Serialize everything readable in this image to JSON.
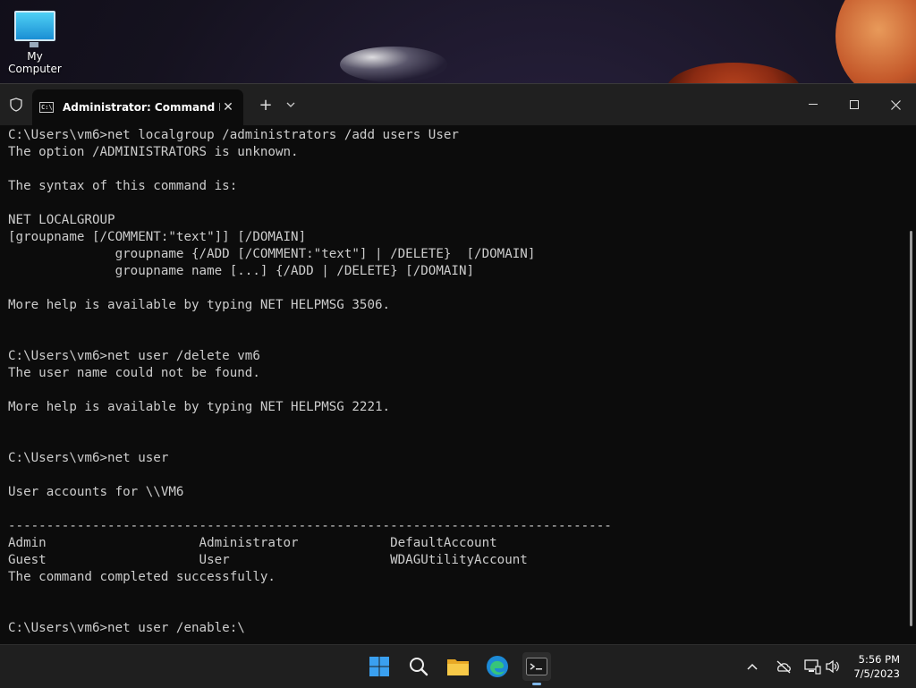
{
  "desktop": {
    "icon_label": "My Computer"
  },
  "window": {
    "tab_title": "Administrator: Command Prc",
    "cmd_icon_text": "C:\\",
    "new_tab": "+",
    "dropdown": "⌄",
    "close_tab": "✕",
    "minimize": "—",
    "maximize": "☐",
    "close": "✕"
  },
  "console": {
    "lines": [
      "C:\\Users\\vm6>net localgroup /administrators /add users User",
      "The option /ADMINISTRATORS is unknown.",
      "",
      "The syntax of this command is:",
      "",
      "NET LOCALGROUP",
      "[groupname [/COMMENT:\"text\"]] [/DOMAIN]",
      "              groupname {/ADD [/COMMENT:\"text\"] | /DELETE}  [/DOMAIN]",
      "              groupname name [...] {/ADD | /DELETE} [/DOMAIN]",
      "",
      "More help is available by typing NET HELPMSG 3506.",
      "",
      "",
      "C:\\Users\\vm6>net user /delete vm6",
      "The user name could not be found.",
      "",
      "More help is available by typing NET HELPMSG 2221.",
      "",
      "",
      "C:\\Users\\vm6>net user",
      "",
      "User accounts for \\\\VM6",
      "",
      "-------------------------------------------------------------------------------",
      "Admin                    Administrator            DefaultAccount",
      "Guest                    User                     WDAGUtilityAccount",
      "The command completed successfully.",
      "",
      "",
      "C:\\Users\\vm6>net user /enable:\\"
    ]
  },
  "taskbar": {
    "tray_chevron": "^",
    "time": "5:56 PM",
    "date": "7/5/2023"
  },
  "colors": {
    "console_bg": "#0c0c0c",
    "console_text": "#cccccc",
    "titlebar": "#202020",
    "taskbar": "#1f1f1f"
  }
}
